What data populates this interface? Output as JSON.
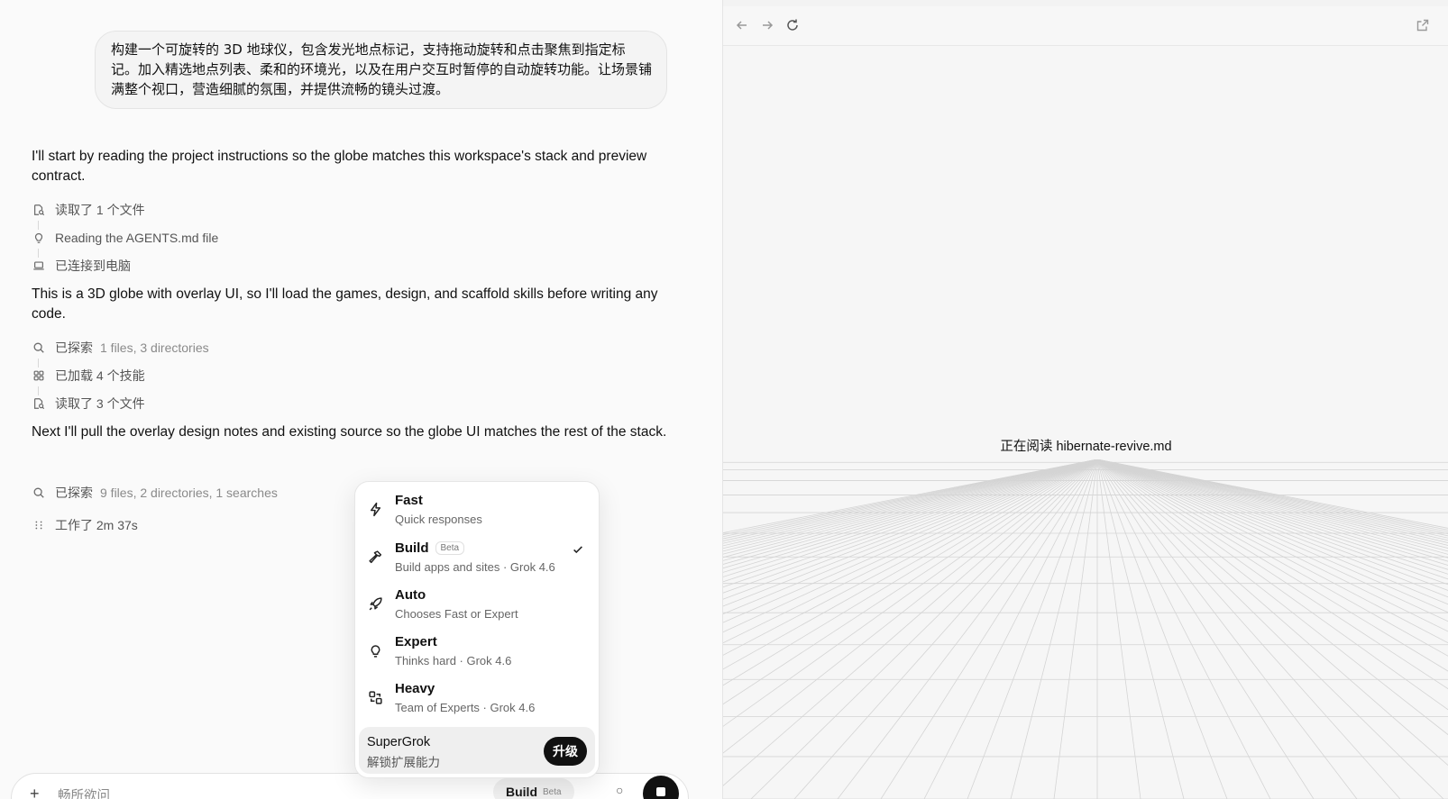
{
  "chat": {
    "user_prompt": "构建一个可旋转的 3D 地球仪，包含发光地点标记，支持拖动旋转和点击聚焦到指定标记。加入精选地点列表、柔和的环境光，以及在用户交互时暂停的自动旋转功能。让场景铺满整个视口，营造细腻的氛围，并提供流畅的镜头过渡。",
    "messages": [
      "I'll start by reading the project instructions so the globe matches this workspace's stack and preview contract.",
      "This is a 3D globe with overlay UI, so I'll load the games, design, and scaffold skills before writing any code.",
      "Next I'll pull the overlay design notes and existing source so the globe UI matches the rest of the stack."
    ],
    "steps_group1": [
      {
        "icon": "file-search-icon",
        "label": "读取了 1 个文件",
        "detail": ""
      },
      {
        "icon": "lightbulb-icon",
        "label": "Reading the AGENTS.md file",
        "detail": ""
      },
      {
        "icon": "laptop-icon",
        "label": "已连接到电脑",
        "detail": ""
      }
    ],
    "steps_group2": [
      {
        "icon": "search-icon",
        "label": "已探索",
        "detail": "1 files, 3 directories"
      },
      {
        "icon": "skills-icon",
        "label": "已加载 4 个技能",
        "detail": ""
      },
      {
        "icon": "file-search-icon",
        "label": "读取了 3 个文件",
        "detail": ""
      }
    ],
    "steps_group3": [
      {
        "icon": "search-icon",
        "label": "已探索",
        "detail": "9 files, 2 directories, 1 searches"
      },
      {
        "icon": "dots-icon",
        "label": "工作了 2m 37s",
        "detail": ""
      }
    ]
  },
  "mode_menu": {
    "options": [
      {
        "icon": "lightning-icon",
        "title": "Fast",
        "desc": "Quick responses",
        "badge": "",
        "selected": false
      },
      {
        "icon": "hammer-icon",
        "title": "Build",
        "desc": "Build apps and sites · Grok 4.6",
        "badge": "Beta",
        "selected": true
      },
      {
        "icon": "rocket-icon",
        "title": "Auto",
        "desc": "Chooses Fast or Expert",
        "badge": "",
        "selected": false
      },
      {
        "icon": "lightbulb-icon",
        "title": "Expert",
        "desc": "Thinks hard · Grok 4.6",
        "badge": "",
        "selected": false
      },
      {
        "icon": "team-icon",
        "title": "Heavy",
        "desc": "Team of Experts · Grok 4.6",
        "badge": "",
        "selected": false
      }
    ],
    "promo": {
      "title": "SuperGrok",
      "desc": "解锁扩展能力",
      "button": "升级"
    }
  },
  "composer": {
    "placeholder": "畅所欲问",
    "mode_label": "Build",
    "mode_badge": "Beta"
  },
  "preview": {
    "status_prefix": "正在阅读",
    "status_file": "hibernate-revive.md"
  }
}
